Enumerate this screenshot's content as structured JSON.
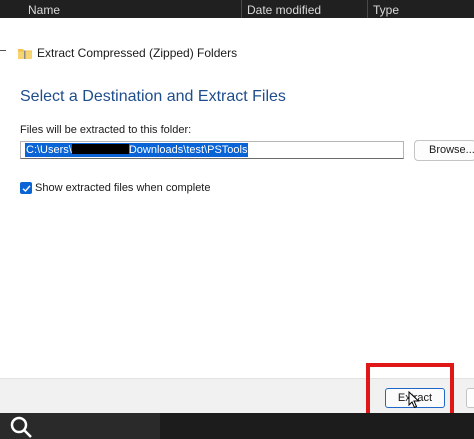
{
  "explorer": {
    "columns": [
      "Name",
      "Date modified",
      "Type"
    ]
  },
  "dialog": {
    "title": "Extract Compressed (Zipped) Folders",
    "heading": "Select a Destination and Extract Files",
    "destination_label": "Files will be extracted to this folder:",
    "path_prefix": "C:\\Users\\",
    "path_suffix": "Downloads\\test\\PSTools",
    "browse_label": "Browse...",
    "show_files_label": "Show extracted files when complete",
    "show_files_checked": true,
    "extract_label": "Extract"
  },
  "colors": {
    "accent": "#0a64d6",
    "heading": "#1e4d8c",
    "highlight": "#e01717"
  },
  "icons": [
    "zip-folder-icon",
    "checkmark-icon",
    "mouse-cursor-icon",
    "search-icon"
  ]
}
